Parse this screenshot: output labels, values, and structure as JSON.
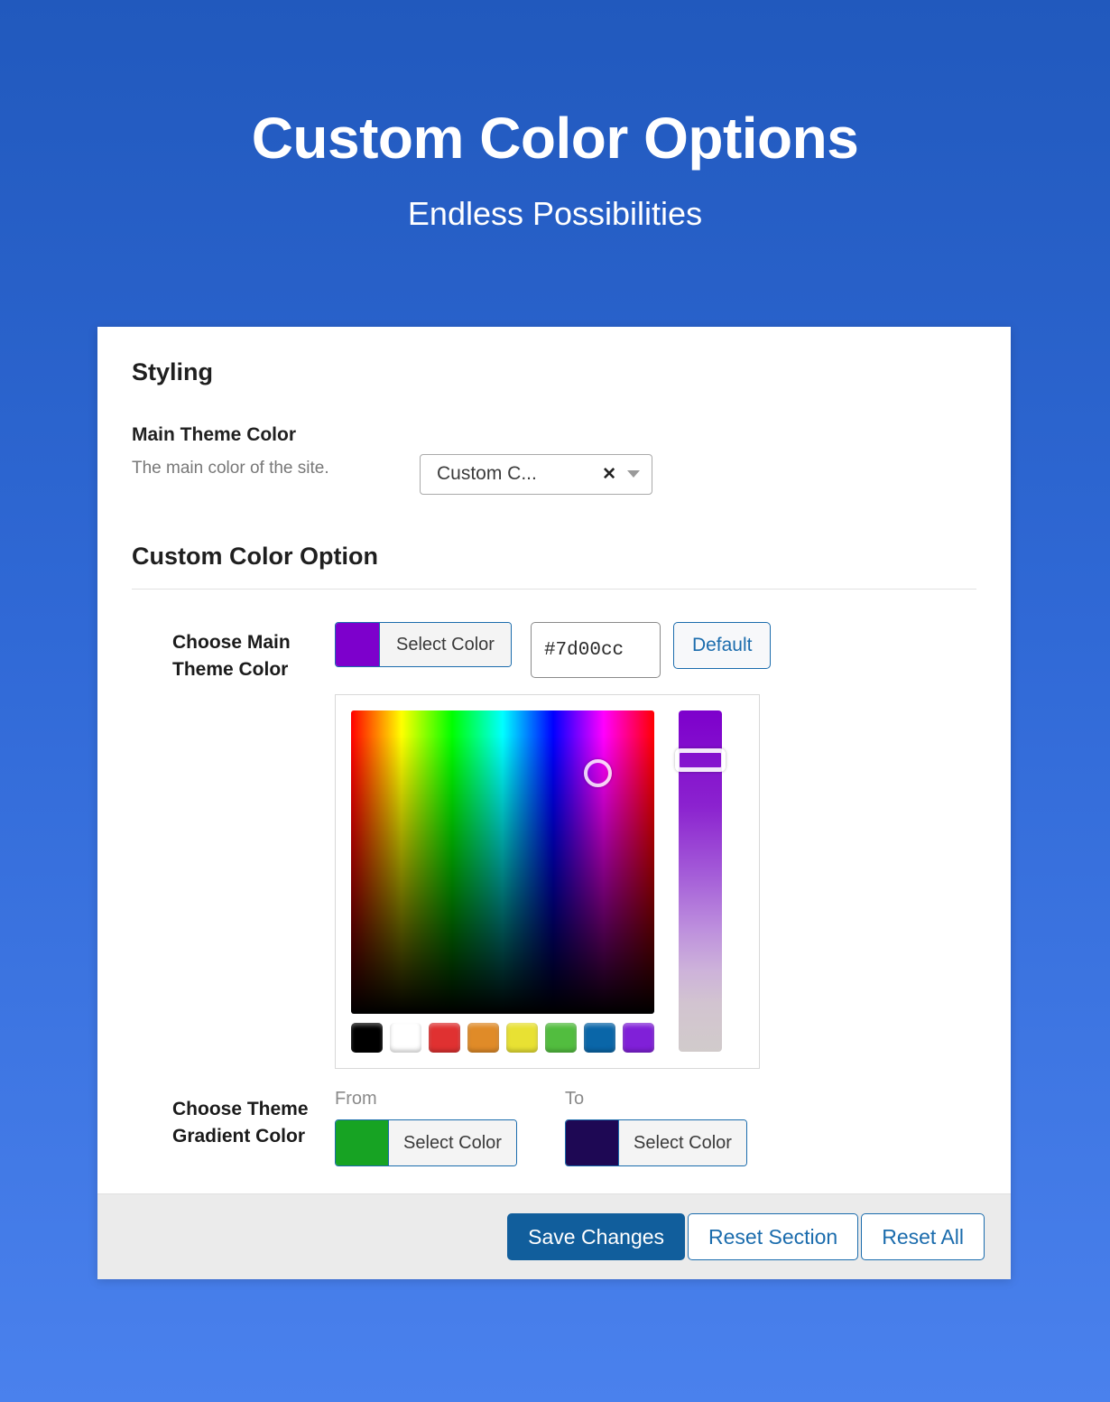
{
  "hero": {
    "title": "Custom Color Options",
    "subtitle": "Endless Possibilities"
  },
  "card": {
    "styling_section_title": "Styling",
    "main_theme": {
      "label": "Main Theme Color",
      "description": "The main color of the site.",
      "select_value": "Custom C...",
      "clear_glyph": "✕"
    },
    "custom_color_option": {
      "title": "Custom Color Option",
      "main_theme_color": {
        "label": "Choose Main Theme Color",
        "select_color_label": "Select Color",
        "swatch_color": "#7d00cc",
        "hex_value": "#7d00cc",
        "default_label": "Default"
      },
      "picker": {
        "selected_color": "#7d00cc",
        "palette": [
          {
            "name": "black",
            "hex": "#000000"
          },
          {
            "name": "white",
            "hex": "#ffffff"
          },
          {
            "name": "red",
            "hex": "#e03131"
          },
          {
            "name": "orange",
            "hex": "#e08b28"
          },
          {
            "name": "yellow",
            "hex": "#e8e133"
          },
          {
            "name": "green",
            "hex": "#52bd3f"
          },
          {
            "name": "blue",
            "hex": "#0a66a8"
          },
          {
            "name": "purple",
            "hex": "#8020d8"
          }
        ]
      },
      "gradient": {
        "label": "Choose Theme Gradient Color",
        "from_caption": "From",
        "from_color": "#17a323",
        "from_button_label": "Select Color",
        "to_caption": "To",
        "to_color": "#1e0854",
        "to_button_label": "Select Color"
      }
    },
    "footer": {
      "save_label": "Save Changes",
      "reset_section_label": "Reset Section",
      "reset_all_label": "Reset All"
    }
  }
}
